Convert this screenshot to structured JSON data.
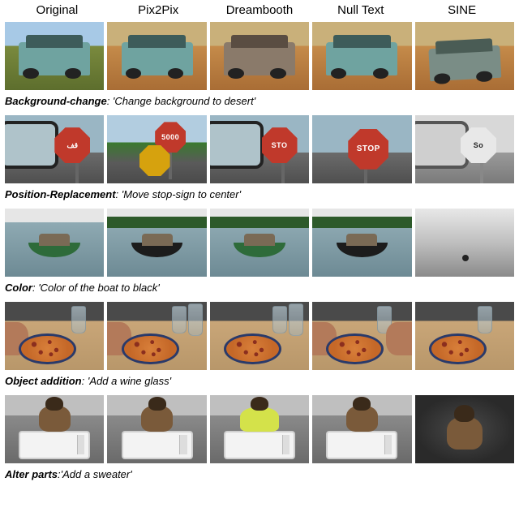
{
  "columns": [
    "Original",
    "Pix2Pix",
    "Dreambooth",
    "Null Text",
    "SINE"
  ],
  "rows": [
    {
      "id": "background-change",
      "label": "Background-change",
      "prompt": "'Change background to desert'",
      "signs": {
        "c1": "قف",
        "c2": "5000",
        "c3": "STO",
        "c4": "STOP",
        "c5": "So"
      }
    },
    {
      "id": "position-replacement",
      "label": "Position-Replacement",
      "prompt": "'Move stop-sign to center'"
    },
    {
      "id": "color",
      "label": "Color",
      "prompt": "'Color of the boat to black'"
    },
    {
      "id": "object-addition",
      "label": "Object addition",
      "prompt": "'Add a wine glass'"
    },
    {
      "id": "alter-parts",
      "label": "Alter parts",
      "prompt": "'Add a sweater'"
    }
  ]
}
